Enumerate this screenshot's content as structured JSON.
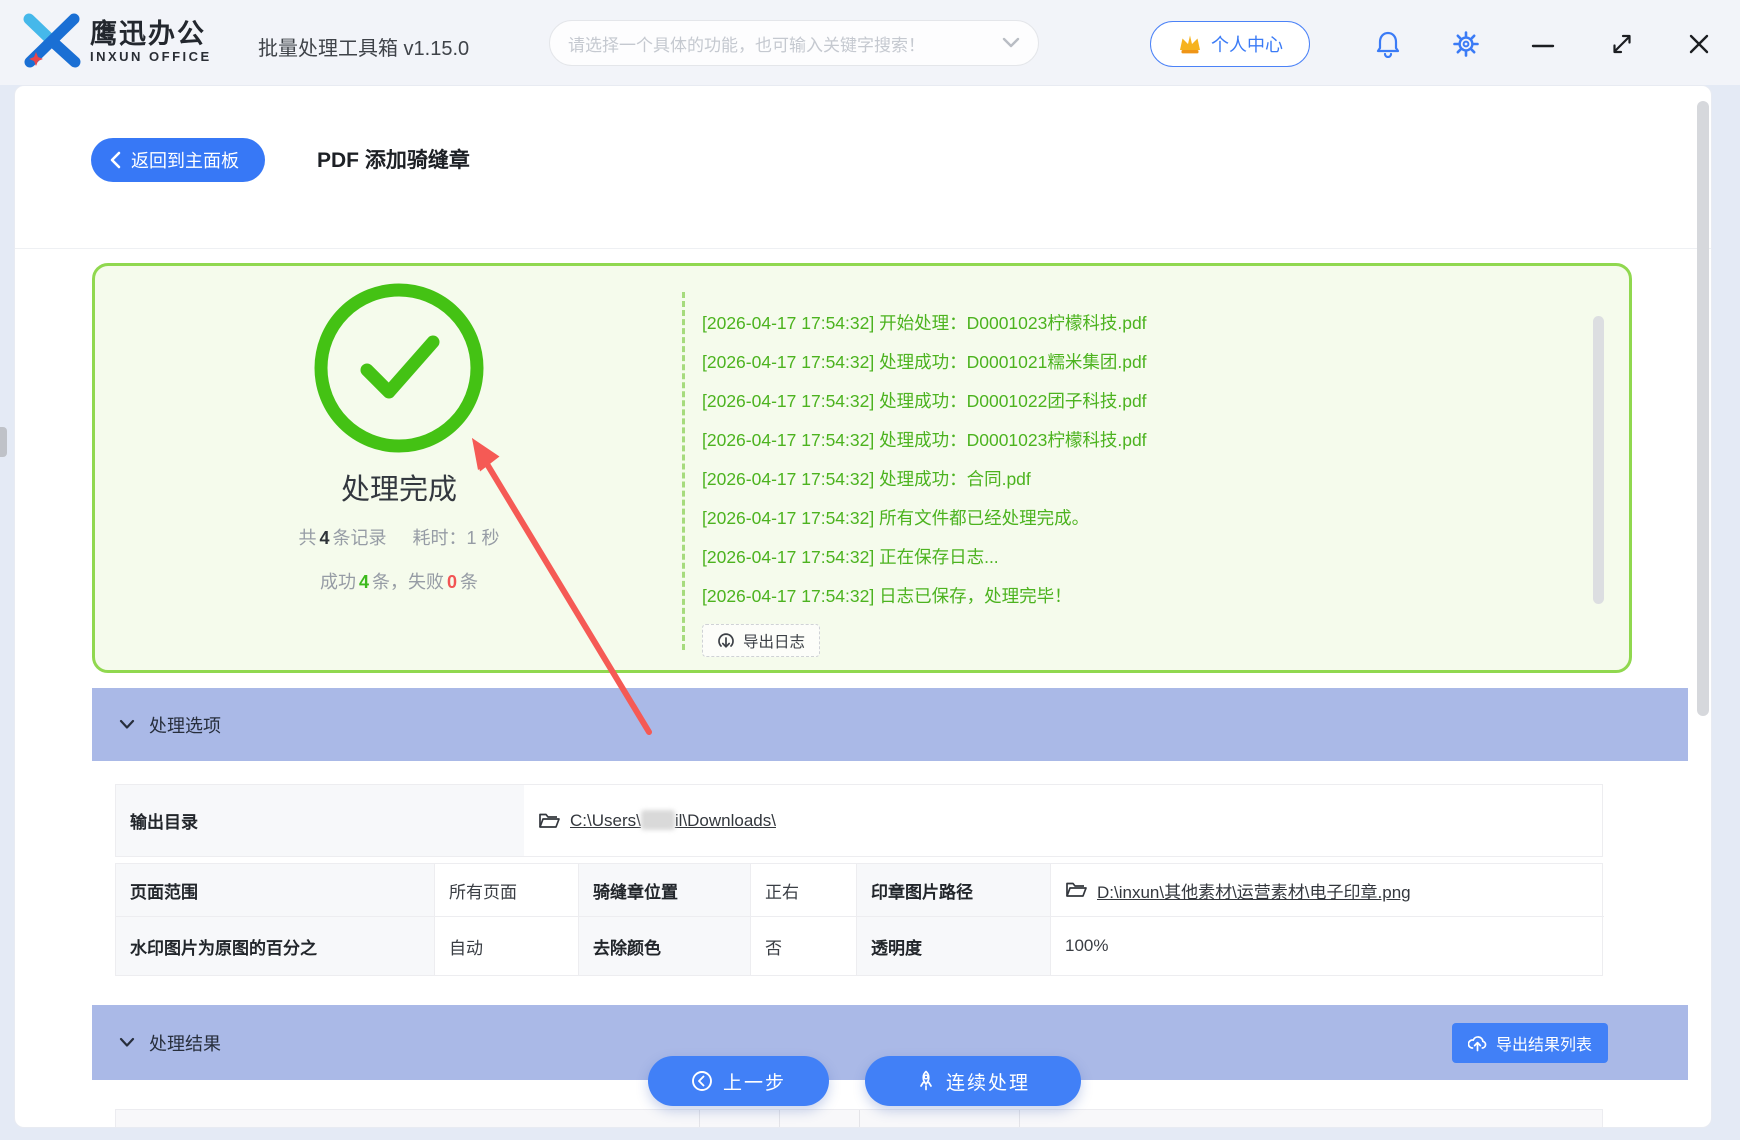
{
  "topbar": {
    "brand_title": "鹰迅办公",
    "brand_subtitle": "INXUN OFFICE",
    "app_title": "批量处理工具箱 v1.15.0",
    "search_placeholder": "请选择一个具体的功能，也可输入关键字搜索！",
    "personal_center": "个人中心"
  },
  "header": {
    "back_label": "返回到主面板",
    "page_title": "PDF 添加骑缝章"
  },
  "result_panel": {
    "status_text": "处理完成",
    "stats": {
      "total_prefix": "共",
      "total": "4",
      "total_suffix": "条记录",
      "elapsed": "耗时：1 秒",
      "success_prefix": "成功",
      "success_count": "4",
      "success_mid": "条，失败",
      "fail_count": "0",
      "fail_suffix": "条"
    },
    "logs": [
      "[2026-04-17 17:54:32] 开始处理：D0001023柠檬科技.pdf",
      "[2026-04-17 17:54:32] 处理成功：D0001021糯米集团.pdf",
      "[2026-04-17 17:54:32] 处理成功：D0001022团子科技.pdf",
      "[2026-04-17 17:54:32] 处理成功：D0001023柠檬科技.pdf",
      "[2026-04-17 17:54:32] 处理成功：合同.pdf",
      "[2026-04-17 17:54:32] 所有文件都已经处理完成。",
      "[2026-04-17 17:54:32] 正在保存日志...",
      "[2026-04-17 17:54:32] 日志已保存，处理完毕！"
    ],
    "export_log_label": "导出日志"
  },
  "options": {
    "section_title": "处理选项",
    "output_dir": {
      "label": "输出目录",
      "path_prefix": "C:\\Users\\",
      "path_suffix": "il\\Downloads\\"
    },
    "rows": [
      {
        "label": "页面范围",
        "value": "所有页面"
      },
      {
        "label": "骑缝章位置",
        "value": "正右"
      },
      {
        "label": "印章图片路径",
        "value": "D:\\inxun\\其他素材\\运营素材\\电子印章.png"
      },
      {
        "label": "水印图片为原图的百分之",
        "value": "自动"
      },
      {
        "label": "去除颜色",
        "value": "否"
      },
      {
        "label": "透明度",
        "value": "100%"
      }
    ]
  },
  "results": {
    "section_title": "处理结果",
    "export_list_label": "导出结果列表"
  },
  "footer": {
    "prev_label": "上一步",
    "continue_label": "连续处理"
  },
  "colors": {
    "accent_blue": "#3b7bf6",
    "success_green": "#44c214",
    "log_green": "#4cb31f",
    "panel_green_bg": "#f5fbec",
    "panel_green_border": "#90d84f",
    "band_periwinkle": "#aab9e7",
    "fail_red": "#f25454",
    "arrow_red": "#f55a55"
  }
}
